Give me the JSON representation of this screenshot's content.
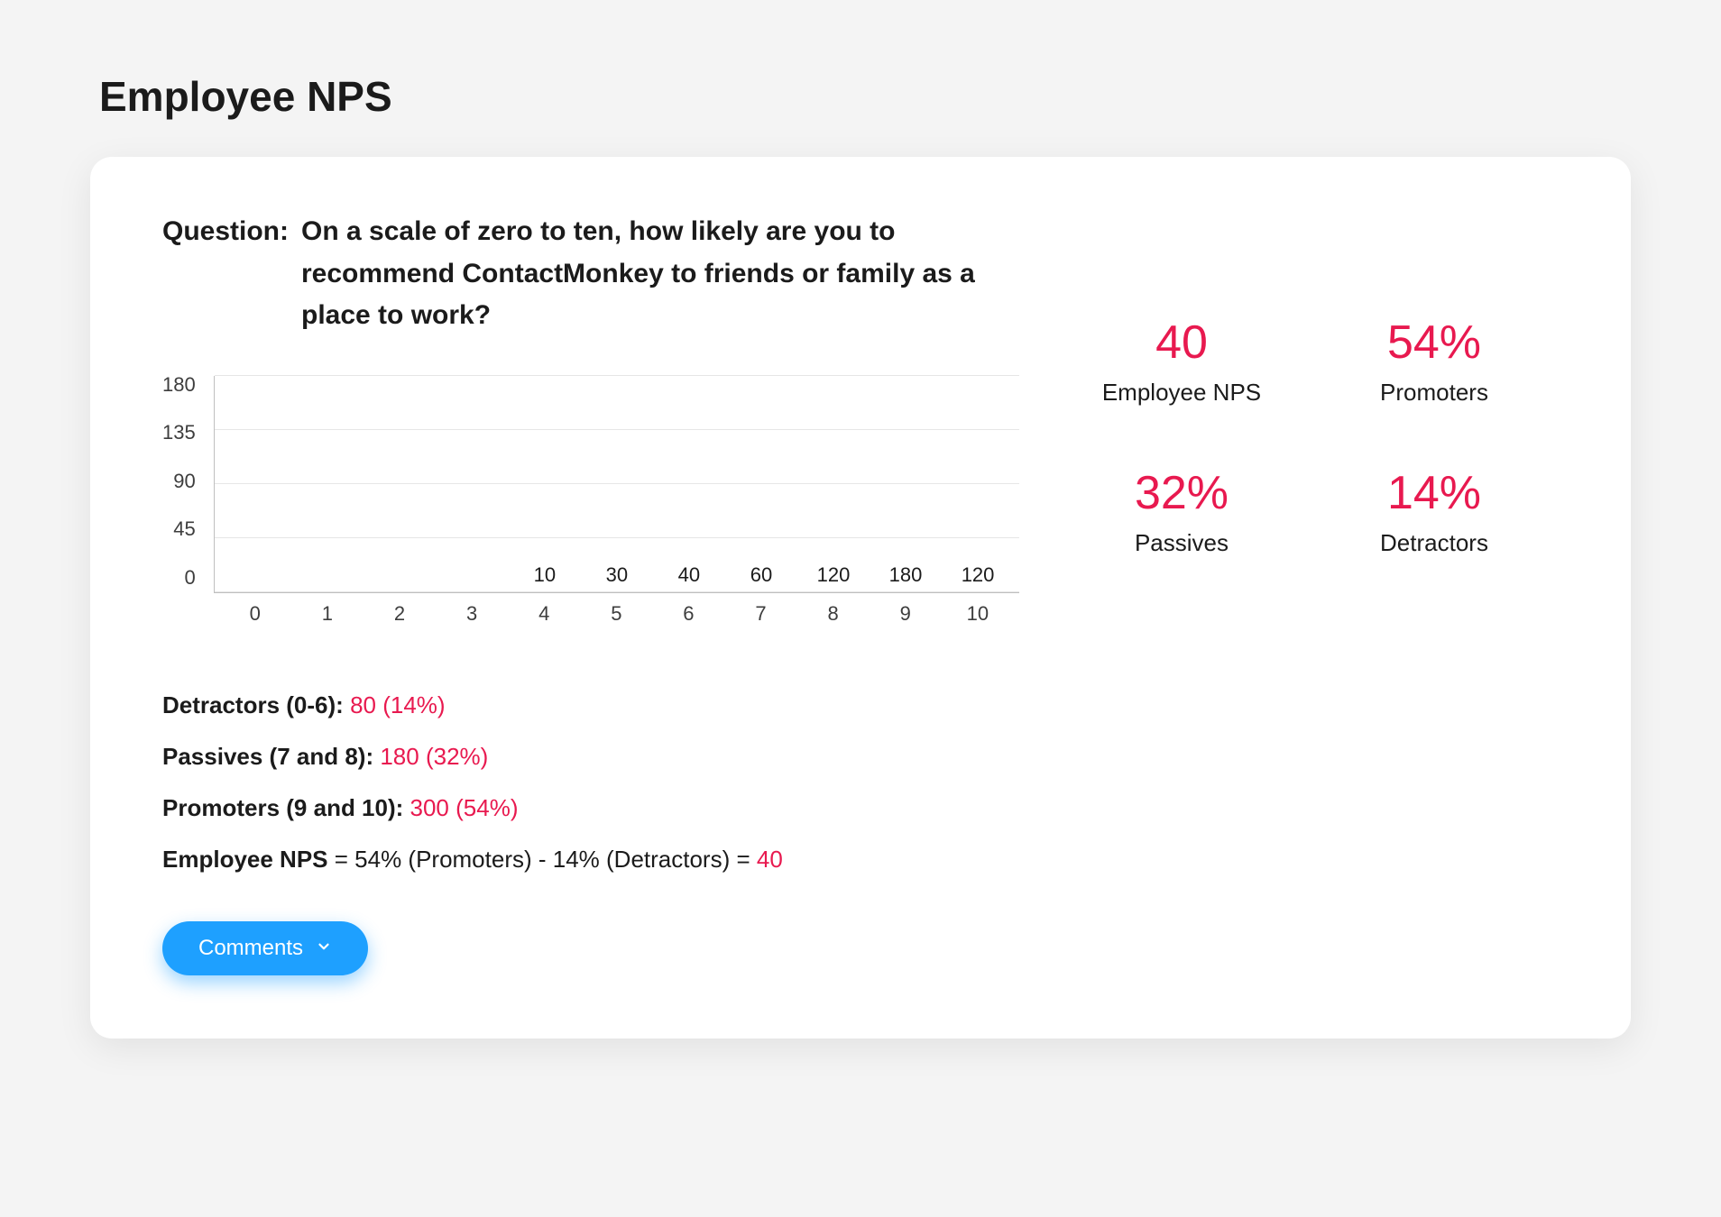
{
  "page_title": "Employee NPS",
  "question_label": "Question:",
  "question_text": "On a scale of zero to ten, how likely are you to recommend ContactMonkey to friends or family as a place to work?",
  "chart_data": {
    "type": "bar",
    "categories": [
      "0",
      "1",
      "2",
      "3",
      "4",
      "5",
      "6",
      "7",
      "8",
      "9",
      "10"
    ],
    "values": [
      0,
      0,
      0,
      0,
      10,
      30,
      40,
      60,
      120,
      180,
      120
    ],
    "show_label": [
      false,
      false,
      false,
      false,
      true,
      true,
      true,
      true,
      true,
      true,
      true
    ],
    "ylabel": "",
    "xlabel": "",
    "yticks": [
      180,
      135,
      90,
      45,
      0
    ],
    "ylim": [
      0,
      180
    ],
    "title": ""
  },
  "breakdown": {
    "detractors_label": "Detractors (0-6): ",
    "detractors_value": "80 (14%)",
    "passives_label": "Passives (7 and 8): ",
    "passives_value": "180 (32%)",
    "promoters_label": "Promoters (9 and 10): ",
    "promoters_value": "300 (54%)",
    "formula_lead": "Employee NPS",
    "formula_body": " = 54% (Promoters) - 14% (Detractors) = ",
    "formula_result": "40"
  },
  "kpis": {
    "nps_value": "40",
    "nps_label": "Employee NPS",
    "promoters_value": "54%",
    "promoters_label": "Promoters",
    "passives_value": "32%",
    "passives_label": "Passives",
    "detractors_value": "14%",
    "detractors_label": "Detractors"
  },
  "comments_button": "Comments",
  "colors": {
    "accent": "#e8194f",
    "button": "#1ea0ff"
  }
}
